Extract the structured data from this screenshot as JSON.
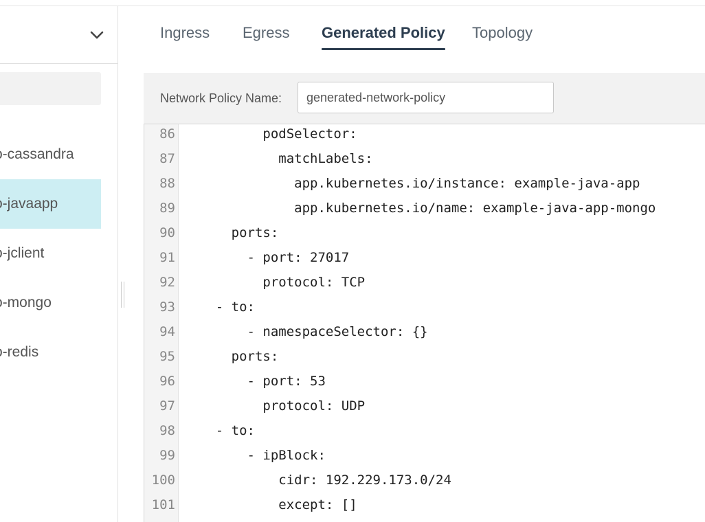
{
  "sidebar": {
    "items": [
      {
        "label": "o-cassandra",
        "active": false
      },
      {
        "label": "o-javaapp",
        "active": true
      },
      {
        "label": "o-jclient",
        "active": false
      },
      {
        "label": "o-mongo",
        "active": false
      },
      {
        "label": "o-redis",
        "active": false
      }
    ]
  },
  "tabs": [
    {
      "label": "Ingress",
      "active": false
    },
    {
      "label": "Egress",
      "active": false
    },
    {
      "label": "Generated Policy",
      "active": true
    },
    {
      "label": "Topology",
      "active": false
    }
  ],
  "policy_name": {
    "label": "Network Policy Name:",
    "value": "generated-network-policy"
  },
  "editor": {
    "lines": [
      {
        "num": "86",
        "text": "          podSelector:"
      },
      {
        "num": "87",
        "text": "            matchLabels:"
      },
      {
        "num": "88",
        "text": "              app.kubernetes.io/instance: example-java-app"
      },
      {
        "num": "89",
        "text": "              app.kubernetes.io/name: example-java-app-mongo"
      },
      {
        "num": "90",
        "text": "      ports:"
      },
      {
        "num": "91",
        "text": "        - port: 27017"
      },
      {
        "num": "92",
        "text": "          protocol: TCP"
      },
      {
        "num": "93",
        "text": "    - to:"
      },
      {
        "num": "94",
        "text": "        - namespaceSelector: {}"
      },
      {
        "num": "95",
        "text": "      ports:"
      },
      {
        "num": "96",
        "text": "        - port: 53"
      },
      {
        "num": "97",
        "text": "          protocol: UDP"
      },
      {
        "num": "98",
        "text": "    - to:"
      },
      {
        "num": "99",
        "text": "        - ipBlock:"
      },
      {
        "num": "100",
        "text": "            cidr: 192.229.173.0/24"
      },
      {
        "num": "101",
        "text": "            except: []"
      }
    ]
  },
  "colors": {
    "accent": "#2d3e50",
    "selected_item": "#cdeef3",
    "panel": "#f2f2f2"
  },
  "icons": {
    "dropdown": "chevron-down-icon"
  }
}
